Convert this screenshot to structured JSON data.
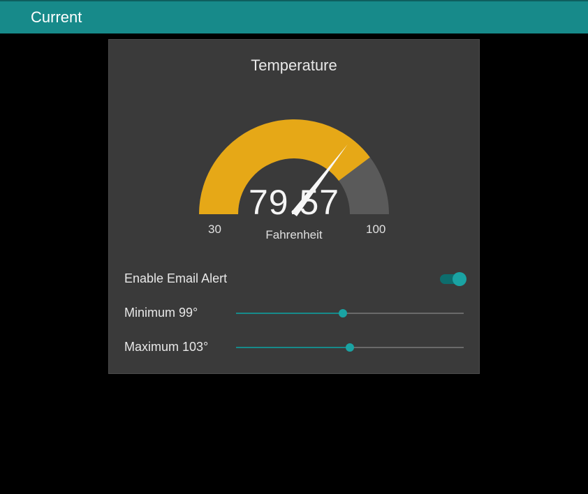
{
  "header": {
    "title": "Current"
  },
  "card": {
    "title": "Temperature"
  },
  "gauge": {
    "value": "79.57",
    "unit": "Fahrenheit",
    "min": "30",
    "max": "100"
  },
  "alert": {
    "label": "Enable Email Alert",
    "enabled": true
  },
  "minimum": {
    "label": "Minimum 99°",
    "percent": 47
  },
  "maximum": {
    "label": "Maximum 103°",
    "percent": 50
  },
  "chart_data": {
    "type": "gauge",
    "title": "Temperature",
    "unit": "Fahrenheit",
    "min": 30,
    "max": 100,
    "value": 79.57,
    "fill_color": "#e6a817",
    "track_color": "#5a5a5a"
  }
}
